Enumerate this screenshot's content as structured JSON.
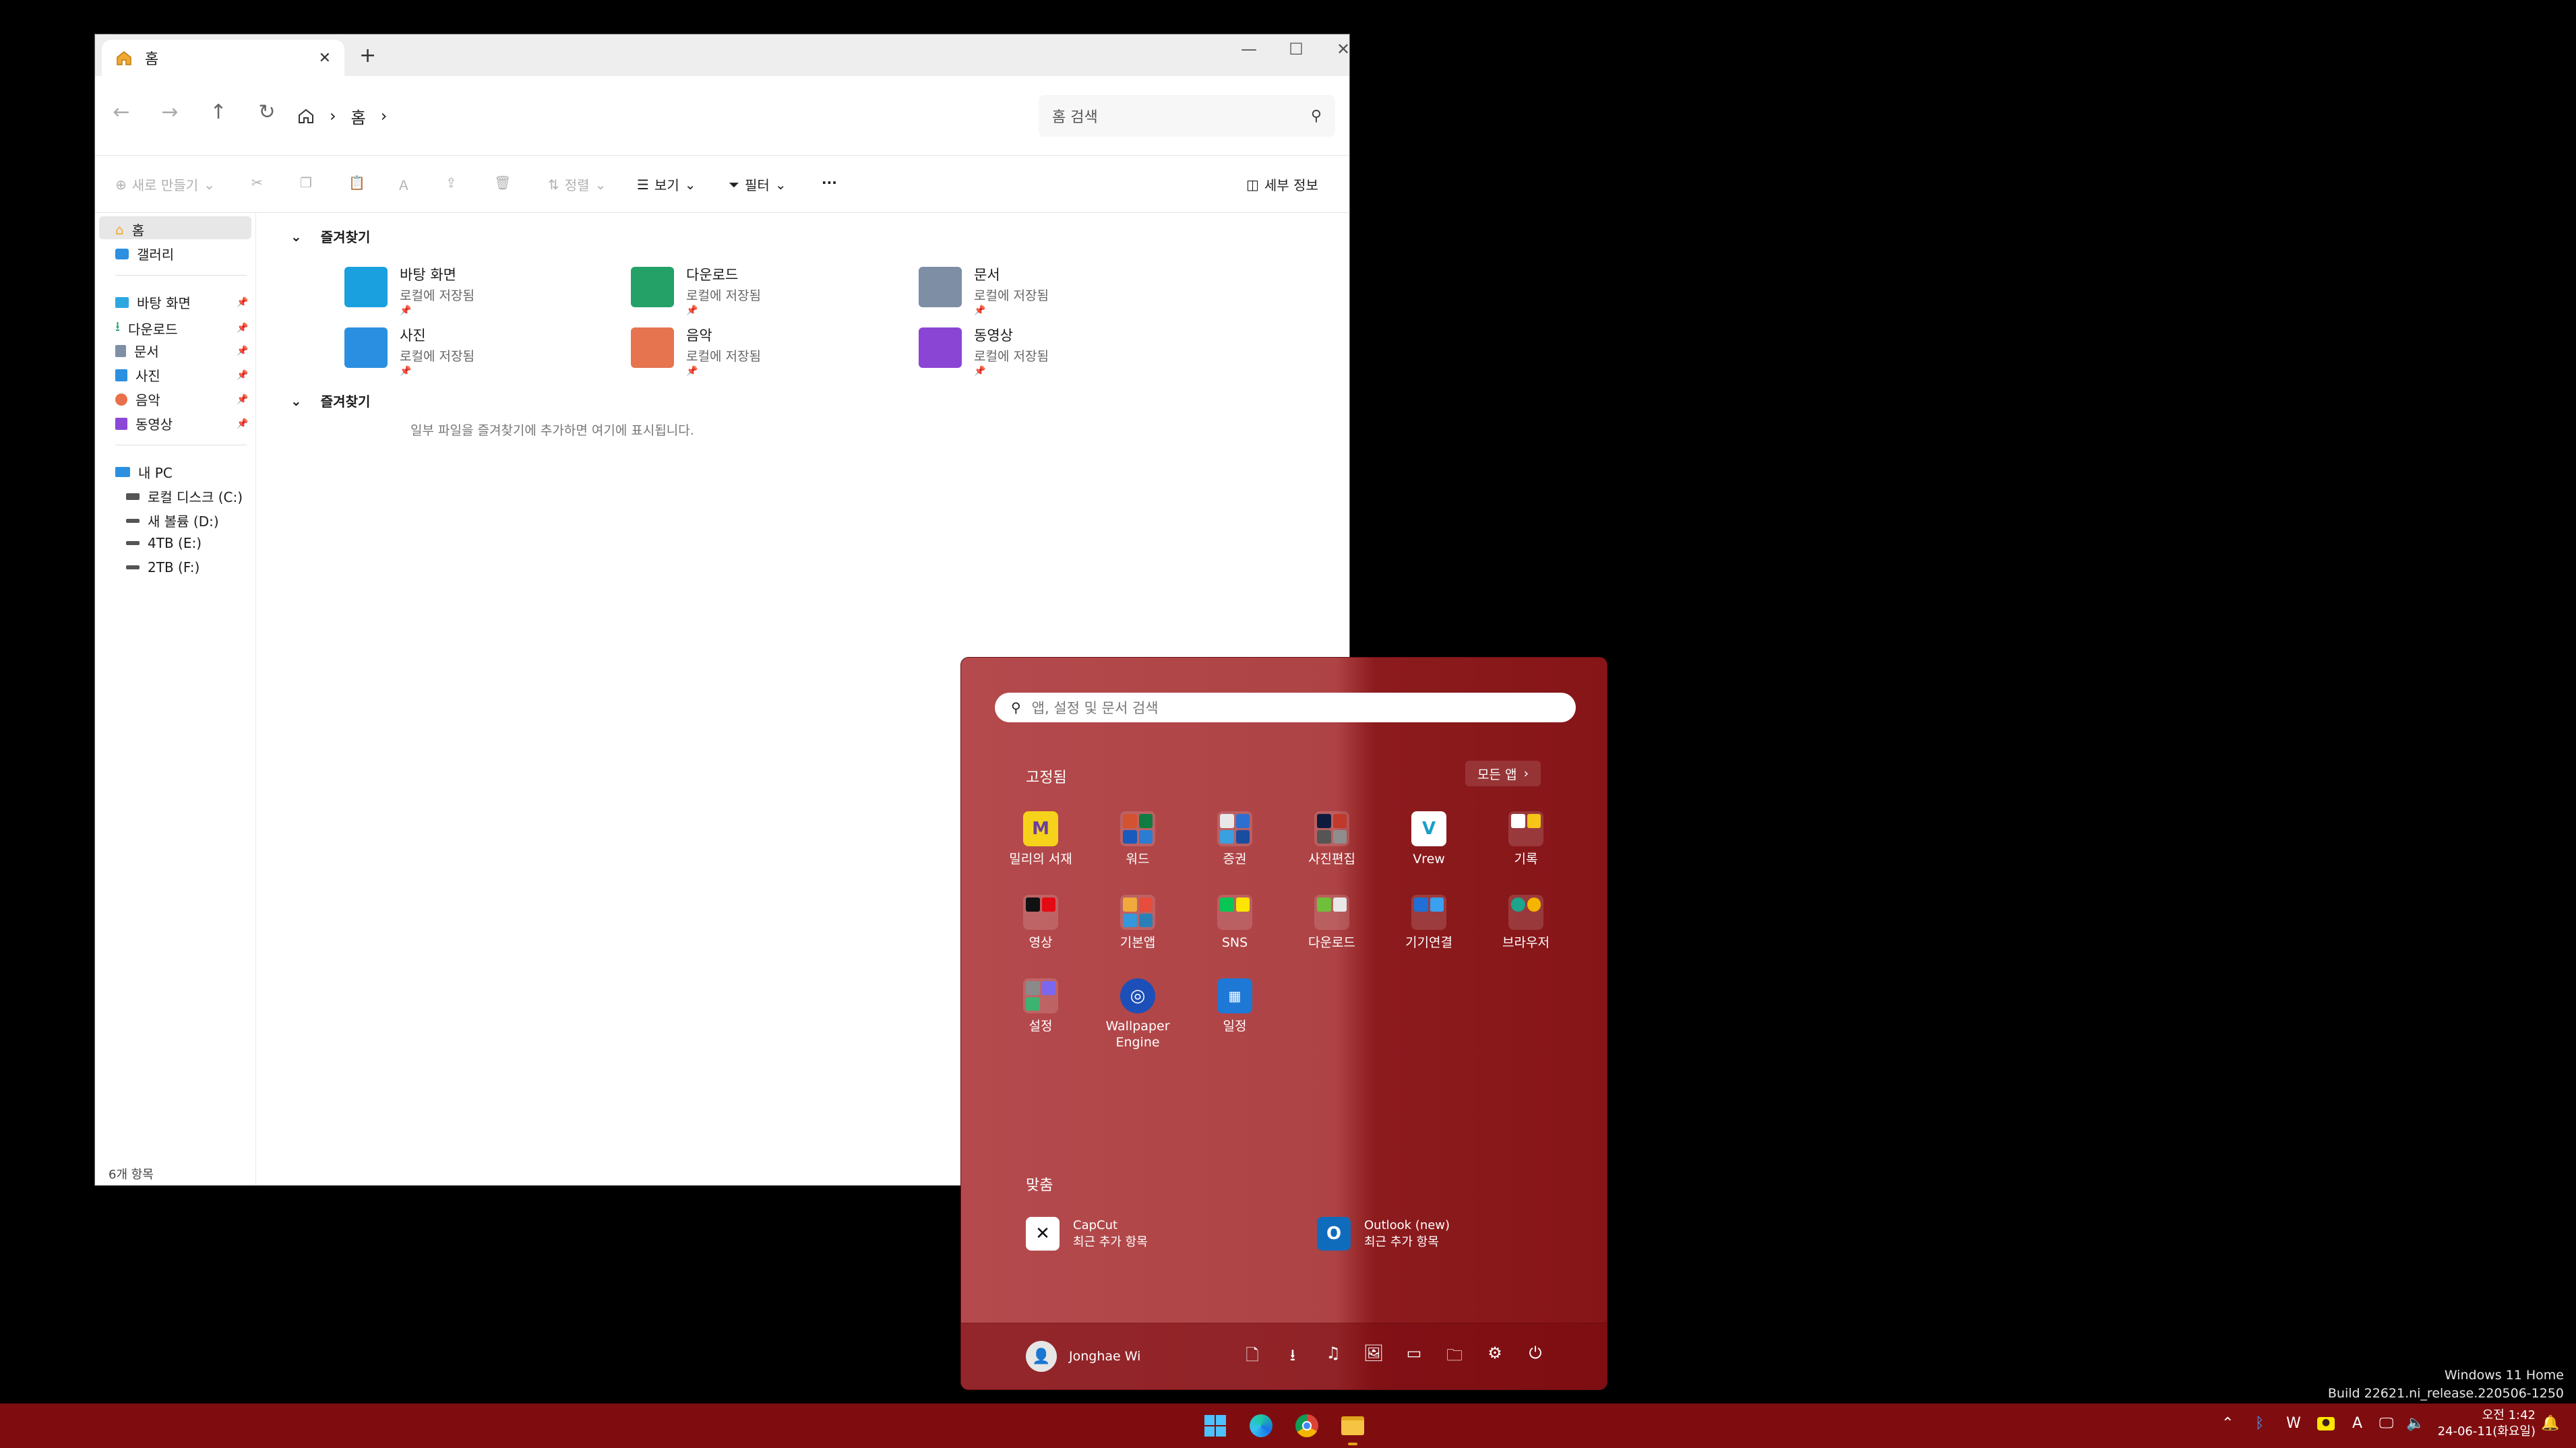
{
  "explorer": {
    "tab_title": "홈",
    "new_tab": "+",
    "window_controls": {
      "minimize": "—",
      "maximize": "☐",
      "close": "✕"
    },
    "nav": {
      "back": "←",
      "forward": "→",
      "up": "↑",
      "refresh": "↻"
    },
    "breadcrumb": {
      "home_icon": "home-icon",
      "location": "홈",
      "sep": "›"
    },
    "search_placeholder": "홈 검색",
    "toolbar": {
      "new": "새로 만들기",
      "sort": "정렬",
      "view": "보기",
      "filter": "필터",
      "more": "···",
      "details": "세부 정보"
    },
    "sidebar": {
      "top": [
        {
          "label": "홈",
          "icon": "home-icon"
        },
        {
          "label": "갤러리",
          "icon": "gallery-icon"
        }
      ],
      "quick": [
        {
          "label": "바탕 화면",
          "icon": "desktop-folder-icon",
          "color": "#2ca7e0"
        },
        {
          "label": "다운로드",
          "icon": "download-folder-icon",
          "color": "#2aa36b"
        },
        {
          "label": "문서",
          "icon": "documents-folder-icon",
          "color": "#7f8fa6"
        },
        {
          "label": "사진",
          "icon": "pictures-folder-icon",
          "color": "#2c8fe0"
        },
        {
          "label": "음악",
          "icon": "music-folder-icon",
          "color": "#e8704a"
        },
        {
          "label": "동영상",
          "icon": "videos-folder-icon",
          "color": "#8b48d6"
        }
      ],
      "pc": [
        {
          "label": "내 PC",
          "icon": "pc-icon"
        },
        {
          "label": "로컬 디스크 (C:)",
          "icon": "drive-icon"
        },
        {
          "label": "새 볼륨 (D:)",
          "icon": "drive-icon"
        },
        {
          "label": "4TB (E:)",
          "icon": "drive-icon"
        },
        {
          "label": "2TB (F:)",
          "icon": "drive-icon"
        }
      ]
    },
    "section_quick": "즐겨찾기",
    "section_favorites": "즐겨찾기",
    "favorites_hint": "일부 파일을 즐겨찾기에 추가하면 여기에 표시됩니다.",
    "folders": [
      {
        "name": "바탕 화면",
        "sub": "로컬에 저장됨",
        "color": "#1aa0de"
      },
      {
        "name": "다운로드",
        "sub": "로컬에 저장됨",
        "color": "#23a167"
      },
      {
        "name": "문서",
        "sub": "로컬에 저장됨",
        "color": "#7d8ea5"
      },
      {
        "name": "사진",
        "sub": "로컬에 저장됨",
        "color": "#2a8fe0"
      },
      {
        "name": "음악",
        "sub": "로컬에 저장됨",
        "color": "#e5744f"
      },
      {
        "name": "동영상",
        "sub": "로컬에 저장됨",
        "color": "#8a45d4"
      }
    ],
    "status": "6개 항목"
  },
  "start": {
    "search_placeholder": "앱, 설정 및 문서 검색",
    "pinned_title": "고정됨",
    "all_apps": "모든 앱",
    "apps": [
      {
        "label": "밀리의 서재",
        "icon": "millie-icon"
      },
      {
        "label": "워드",
        "icon": "office-folder-icon"
      },
      {
        "label": "증권",
        "icon": "stocks-folder-icon"
      },
      {
        "label": "사진편집",
        "icon": "photo-edit-folder-icon"
      },
      {
        "label": "Vrew",
        "icon": "vrew-icon"
      },
      {
        "label": "기록",
        "icon": "notes-folder-icon"
      },
      {
        "label": "영상",
        "icon": "video-folder-icon"
      },
      {
        "label": "기본앱",
        "icon": "basic-apps-folder-icon"
      },
      {
        "label": "SNS",
        "icon": "sns-folder-icon"
      },
      {
        "label": "다운로드",
        "icon": "download-apps-folder-icon"
      },
      {
        "label": "기기연결",
        "icon": "device-link-folder-icon"
      },
      {
        "label": "브라우저",
        "icon": "browser-folder-icon"
      },
      {
        "label": "설정",
        "icon": "settings-folder-icon"
      },
      {
        "label": "Wallpaper Engine",
        "icon": "wallpaper-engine-icon"
      },
      {
        "label": "일정",
        "icon": "calendar-icon"
      }
    ],
    "recommended_title": "맞춤",
    "recommended": [
      {
        "name": "CapCut",
        "sub": "최근 추가 항목",
        "icon": "capcut-icon"
      },
      {
        "name": "Outlook (new)",
        "sub": "최근 추가 항목",
        "icon": "outlook-icon"
      }
    ],
    "user": "Jonghae Wi",
    "footer_icons": [
      "document-icon",
      "download-icon",
      "music-icon",
      "picture-icon",
      "video-icon",
      "folder-icon",
      "settings-icon",
      "power-icon"
    ]
  },
  "watermark": {
    "line1": "Windows 11 Home",
    "line2": "Build 22621.ni_release.220506-1250"
  },
  "taskbar": {
    "apps": [
      "start-icon",
      "edge-icon",
      "chrome-icon",
      "file-explorer-icon"
    ],
    "tray": [
      "chevron-up-icon",
      "bluetooth-icon",
      "app-tray-icon",
      "kakaotalk-icon",
      "ime-icon",
      "network-icon",
      "volume-icon"
    ],
    "ime_label": "A",
    "time": "오전 1:42",
    "date": "24-06-11(화요일)"
  }
}
